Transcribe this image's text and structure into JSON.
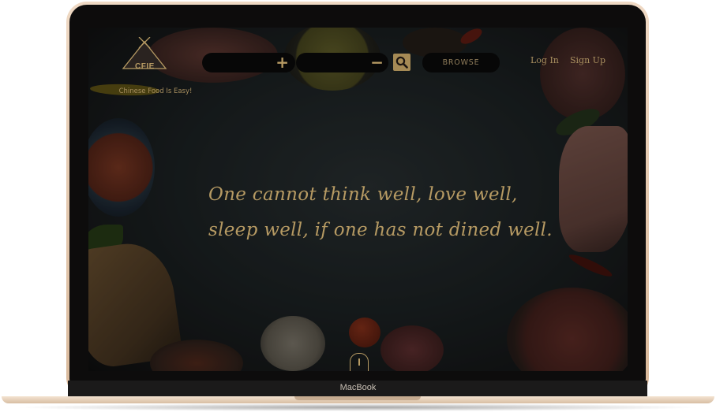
{
  "device": {
    "brand_label": "MacBook"
  },
  "site": {
    "logo_text": "CFIE",
    "tagline": "Chinese Food Is Easy!"
  },
  "header": {
    "include_sign": "+",
    "exclude_sign": "−",
    "browse_label": "BROWSE",
    "login_label": "Log In",
    "signup_label": "Sign Up"
  },
  "hero": {
    "quote_line1": "One cannot think well, love well,",
    "quote_line2": "sleep well, if one has not dined well."
  },
  "colors": {
    "accent": "#b69a63",
    "search_button": "#a58a55",
    "pill_bg": "#070707"
  },
  "icons": [
    "logo-icon",
    "plus-icon",
    "minus-icon",
    "search-icon",
    "scroll-mouse-icon"
  ]
}
